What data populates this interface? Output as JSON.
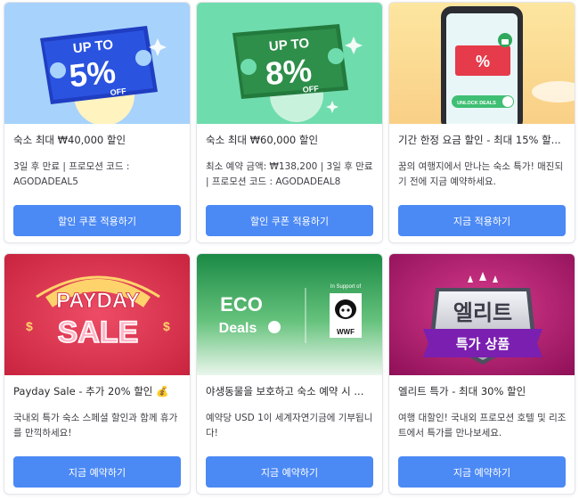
{
  "cards": [
    {
      "banner": {
        "badge_line1": "UP TO",
        "badge_value": "5%",
        "badge_line3": "OFF",
        "bg": "#a7d2fb",
        "ticket": "#1f3ec2"
      },
      "title": "숙소 최대 ₩40,000 할인",
      "description": "3일 후 만료 | 프로모션 코드 : AGODADEAL5",
      "button": "할인 쿠폰 적용하기"
    },
    {
      "banner": {
        "badge_line1": "UP TO",
        "badge_value": "8%",
        "badge_line3": "OFF",
        "bg": "#6fdcae",
        "ticket": "#237a3d"
      },
      "title": "숙소 최대 ₩60,000 할인",
      "description": "최소 예약 금액: ₩138,200 | 3일 후 만료 | 프로모션 코드 : AGODADEAL8",
      "button": "할인 쿠폰 적용하기"
    },
    {
      "banner": {
        "phone_badge": "%",
        "unlock_label": "UNLOCK DEALS",
        "bg": "#fde6a0"
      },
      "title": "기간 한정 요금 할인 - 최대 15% 할...",
      "description": "꿈의 여행지에서 만나는 숙소 특가! 매진되기 전에 지금 예약하세요.",
      "button": "지금 적용하기"
    },
    {
      "banner": {
        "word1": "PAYDAY",
        "word2": "SALE",
        "bg": "#e23a55"
      },
      "title": "Payday Sale - 추가 20% 할인 💰",
      "description": "국내외 특가 숙소 스페셜 할인과 함께 휴가를 만끽하세요!",
      "button": "지금 예약하기"
    },
    {
      "banner": {
        "eco": "ECO",
        "deals": "Deals",
        "support": "In Support of",
        "wwf": "WWF",
        "bg": "#1f8e4a"
      },
      "title": "야생동물을 보호하고 숙소 예약 시 ...",
      "description": "예약당 USD 1이 세계자연기금에 기부됩니다!",
      "button": "지금 예약하기"
    },
    {
      "banner": {
        "word1": "엘리트",
        "word2": "특가 상품",
        "bg": "#b51870"
      },
      "title": "엘리트 특가 - 최대 30% 할인",
      "description": "여행 대할인! 국내외 프로모션 호텔 및 리조트에서 특가를 만나보세요.",
      "button": "지금 예약하기"
    }
  ]
}
